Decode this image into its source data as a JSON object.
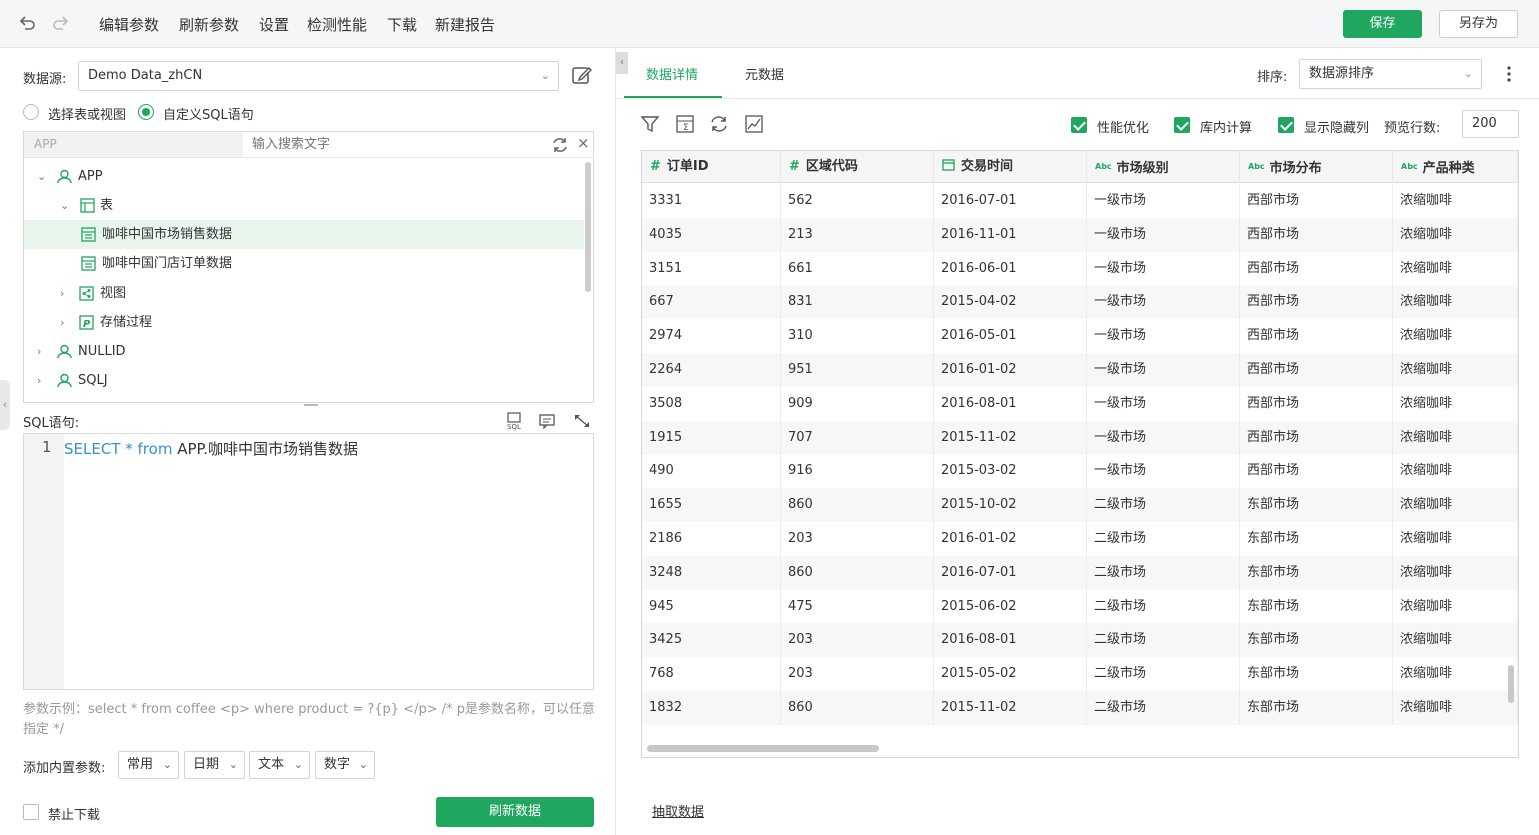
{
  "toolbar": {
    "undo_icon": "undo-icon",
    "redo_icon": "redo-icon",
    "menu": [
      "编辑参数",
      "刷新参数",
      "设置",
      "检测性能",
      "下载",
      "新建报告"
    ],
    "save_label": "保存",
    "save_as_label": "另存为",
    "accent": "#1fa760"
  },
  "left": {
    "datasource_label": "数据源:",
    "datasource_value": "Demo Data_zhCN",
    "radio_table": "选择表或视图",
    "radio_sql": "自定义SQL语句",
    "tree_schema_filter": "APP",
    "tree_search_placeholder": "输入搜索文字",
    "tree": {
      "app": "APP",
      "tables": "表",
      "table1": "咖啡中国市场销售数据",
      "table2": "咖啡中国门店订单数据",
      "views": "视图",
      "procs": "存储过程",
      "nullid": "NULLID",
      "sqlj": "SQLJ"
    },
    "sql_label": "SQL语句:",
    "sql_line_no": "1",
    "sql_kw1": "SELECT",
    "sql_star": " * ",
    "sql_kw2": "from",
    "sql_rest": " APP.咖啡中国市场销售数据",
    "param_hint": "参数示例：select * from coffee <p> where product = ?{p} </p> /* p是参数名称，可以任意指定 */",
    "builtin_label": "添加内置参数:",
    "builtin_options": [
      "常用",
      "日期",
      "文本",
      "数字"
    ],
    "disable_download": "禁止下载",
    "refresh_button": "刷新数据"
  },
  "right": {
    "tab_detail": "数据详情",
    "tab_meta": "元数据",
    "sort_label": "排序:",
    "sort_value": "数据源排序",
    "opt_perf": "性能优化",
    "opt_db": "库内计算",
    "opt_hidden": "显示隐藏列",
    "preview_label": "预览行数:",
    "preview_value": "200",
    "columns": [
      {
        "type": "#",
        "name": "订单ID"
      },
      {
        "type": "#",
        "name": "区域代码"
      },
      {
        "type": "date",
        "name": "交易时间"
      },
      {
        "type": "Abc",
        "name": "市场级别"
      },
      {
        "type": "Abc",
        "name": "市场分布"
      },
      {
        "type": "Abc",
        "name": "产品种类"
      }
    ],
    "rows": [
      [
        "3331",
        "562",
        "2016-07-01",
        "一级市场",
        "西部市场",
        "浓缩咖啡"
      ],
      [
        "4035",
        "213",
        "2016-11-01",
        "一级市场",
        "西部市场",
        "浓缩咖啡"
      ],
      [
        "3151",
        "661",
        "2016-06-01",
        "一级市场",
        "西部市场",
        "浓缩咖啡"
      ],
      [
        "667",
        "831",
        "2015-04-02",
        "一级市场",
        "西部市场",
        "浓缩咖啡"
      ],
      [
        "2974",
        "310",
        "2016-05-01",
        "一级市场",
        "西部市场",
        "浓缩咖啡"
      ],
      [
        "2264",
        "951",
        "2016-01-02",
        "一级市场",
        "西部市场",
        "浓缩咖啡"
      ],
      [
        "3508",
        "909",
        "2016-08-01",
        "一级市场",
        "西部市场",
        "浓缩咖啡"
      ],
      [
        "1915",
        "707",
        "2015-11-02",
        "一级市场",
        "西部市场",
        "浓缩咖啡"
      ],
      [
        "490",
        "916",
        "2015-03-02",
        "一级市场",
        "西部市场",
        "浓缩咖啡"
      ],
      [
        "1655",
        "860",
        "2015-10-02",
        "二级市场",
        "东部市场",
        "浓缩咖啡"
      ],
      [
        "2186",
        "203",
        "2016-01-02",
        "二级市场",
        "东部市场",
        "浓缩咖啡"
      ],
      [
        "3248",
        "860",
        "2016-07-01",
        "二级市场",
        "东部市场",
        "浓缩咖啡"
      ],
      [
        "945",
        "475",
        "2015-06-02",
        "二级市场",
        "东部市场",
        "浓缩咖啡"
      ],
      [
        "3425",
        "203",
        "2016-08-01",
        "二级市场",
        "东部市场",
        "浓缩咖啡"
      ],
      [
        "768",
        "203",
        "2015-05-02",
        "二级市场",
        "东部市场",
        "浓缩咖啡"
      ],
      [
        "1832",
        "860",
        "2015-11-02",
        "二级市场",
        "东部市场",
        "浓缩咖啡"
      ]
    ],
    "extract_link": "抽取数据"
  }
}
